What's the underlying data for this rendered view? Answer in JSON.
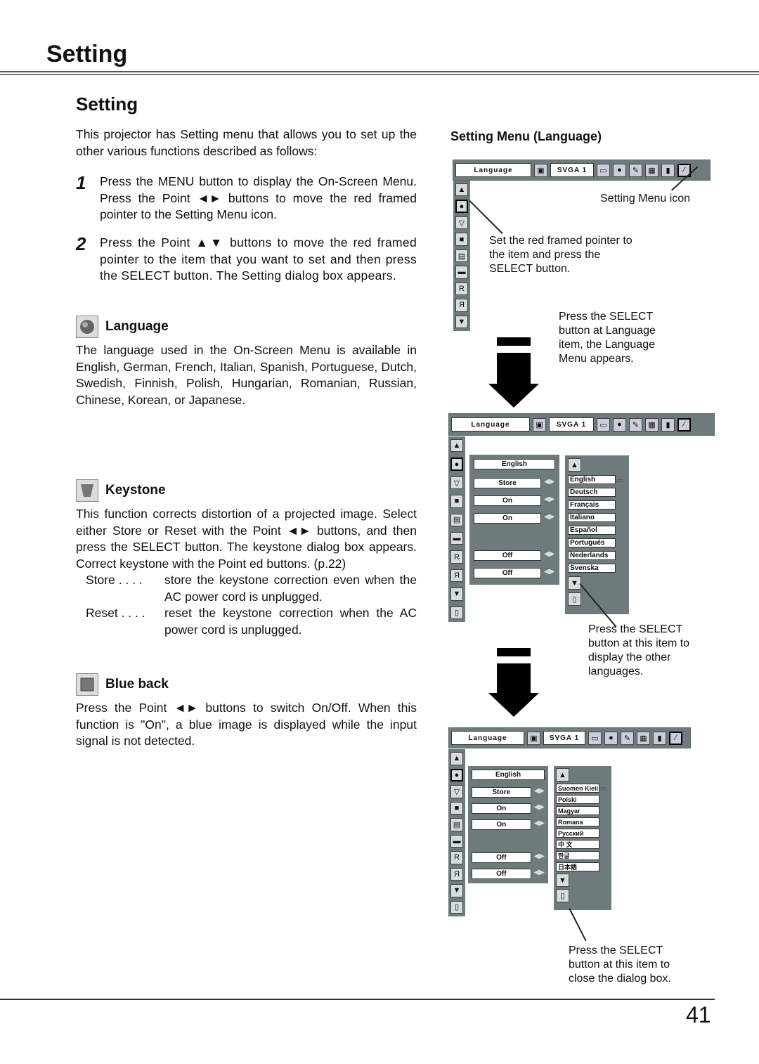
{
  "page": {
    "header_title": "Setting",
    "section_title": "Setting",
    "intro": "This projector has Setting menu that allows you to set up the other various functions described as follows:",
    "steps": [
      {
        "num": "1",
        "text": "Press the MENU button to display the On-Screen Menu.  Press the Point ◄► buttons to move the red framed pointer to the Setting Menu icon."
      },
      {
        "num": "2",
        "text": "Press the Point ▲▼ buttons to move the red framed  pointer to the item that you want to set and then press the SELECT button.  The Setting dialog box appears."
      }
    ],
    "sections": {
      "language": {
        "title": "Language",
        "icon": "globe-icon",
        "text": "The language used in the On-Screen Menu is available in English, German, French, Italian, Spanish, Portuguese, Dutch, Swedish, Finnish, Polish, Hungarian, Romanian, Russian, Chinese, Korean, or Japanese."
      },
      "keystone": {
        "title": "Keystone",
        "icon": "keystone-icon",
        "text": "This function corrects distortion of a projected image. Select either Store or Reset with the Point ◄► buttons, and then press the SELECT button.  The keystone dialog box appears.  Correct keystone with the Point ed buttons. (p.22)",
        "defs": [
          {
            "term": "Store . . . .",
            "desc": "store the keystone correction even when the AC power cord is unplugged."
          },
          {
            "term": "Reset . . . .",
            "desc": "reset the keystone correction when the AC power cord is unplugged."
          }
        ]
      },
      "blueback": {
        "title": "Blue back",
        "icon": "blue-back-icon",
        "text": "Press the Point ◄► buttons to switch On/Off.  When this function is \"On\", a blue image is displayed while the input signal is not detected."
      }
    },
    "page_number": "41"
  },
  "right": {
    "heading": "Setting Menu (Language)",
    "osd": {
      "menu_label": "Language",
      "source": "SVGA 1",
      "settings": [
        "English",
        "Store",
        "On",
        "On",
        "Off",
        "Off"
      ],
      "languages_page1": [
        "English",
        "Deutsch",
        "Français",
        "Italiano",
        "Español",
        "Portugués",
        "Nederlands",
        "Svenska"
      ],
      "languages_page2": [
        "Suomen Kieli",
        "Polski",
        "Magyar",
        "Romana",
        "Русский",
        "中 文",
        "한글",
        "日本語"
      ]
    },
    "notes": {
      "setting_menu_icon": "Setting Menu icon",
      "set_pointer": "Set the red framed pointer to the item and press the SELECT button.",
      "press_select_language": "Press the SELECT button at Language item, the Language Menu appears.",
      "press_select_other": "Press the SELECT button at this item to display the other languages.",
      "press_select_close": "Press the SELECT button at this item to close the dialog box."
    }
  },
  "colors": {
    "osd_panel": "#6e7b7c",
    "text": "#111111"
  }
}
